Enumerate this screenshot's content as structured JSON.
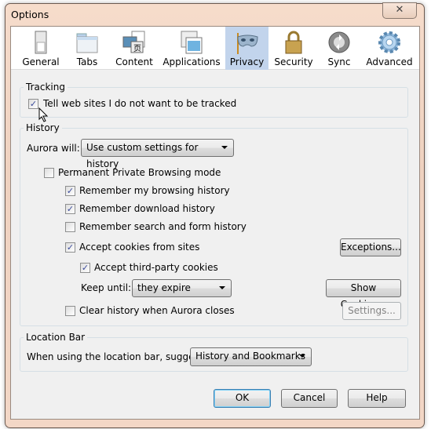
{
  "window": {
    "title": "Options",
    "close_label": "✕"
  },
  "toolbar": {
    "items": [
      {
        "label": "General",
        "icon": "general-switch-icon"
      },
      {
        "label": "Tabs",
        "icon": "tabs-folder-icon"
      },
      {
        "label": "Content",
        "icon": "content-icon"
      },
      {
        "label": "Applications",
        "icon": "applications-icon"
      },
      {
        "label": "Privacy",
        "icon": "privacy-mask-icon",
        "selected": true
      },
      {
        "label": "Security",
        "icon": "security-lock-icon"
      },
      {
        "label": "Sync",
        "icon": "sync-icon"
      },
      {
        "label": "Advanced",
        "icon": "advanced-gear-icon"
      }
    ]
  },
  "tracking": {
    "label": "Tracking",
    "dnt": {
      "label": "Tell web sites I do not want to be tracked",
      "checked": true
    }
  },
  "history": {
    "label": "History",
    "aurora_will_label": "Aurora will:",
    "aurora_will_value": "Use custom settings for history",
    "private_mode": {
      "label": "Permanent Private Browsing mode",
      "checked": false
    },
    "browsing": {
      "label": "Remember my browsing history",
      "checked": true
    },
    "download": {
      "label": "Remember download history",
      "checked": true
    },
    "search": {
      "label": "Remember search and form history",
      "checked": false
    },
    "cookies": {
      "label": "Accept cookies from sites",
      "checked": true
    },
    "third_party": {
      "label": "Accept third-party cookies",
      "checked": true
    },
    "keep_until_label": "Keep until:",
    "keep_until_value": "they expire",
    "clear": {
      "label": "Clear history when Aurora closes",
      "checked": false
    },
    "exceptions_label": "Exceptions...",
    "show_cookies_label": "Show Cookies...",
    "settings_label": "Settings..."
  },
  "location_bar": {
    "label": "Location Bar",
    "suggest_label": "When using the location bar, suggest:",
    "suggest_value": "History and Bookmarks"
  },
  "buttons": {
    "ok": "OK",
    "cancel": "Cancel",
    "help": "Help"
  }
}
